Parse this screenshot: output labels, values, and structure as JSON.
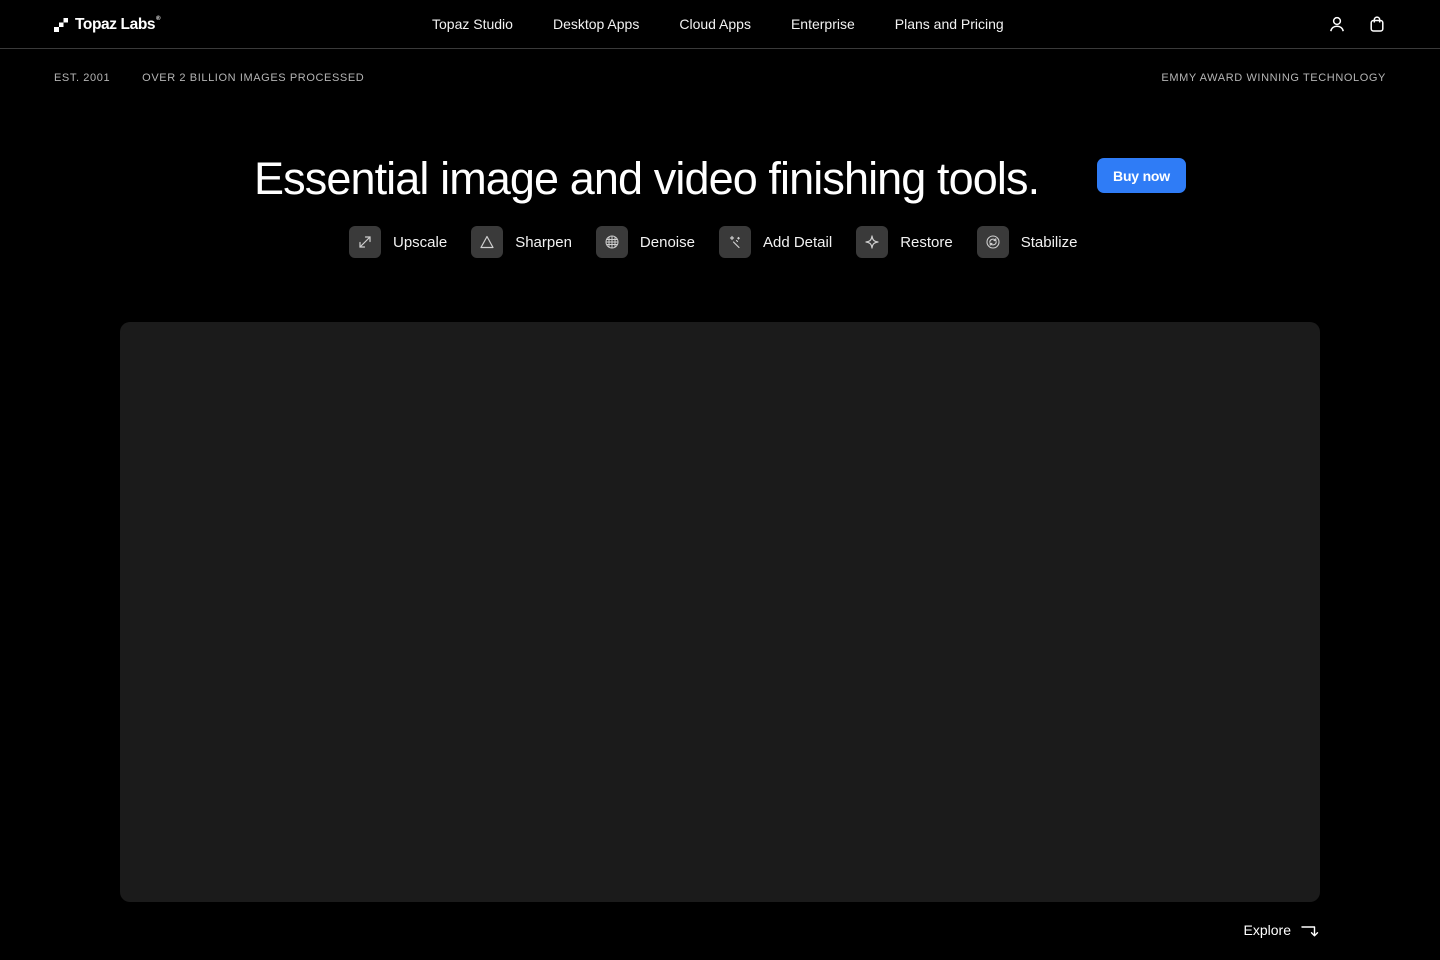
{
  "header": {
    "logo_text": "Topaz Labs",
    "logo_reg": "®",
    "nav": [
      {
        "label": "Topaz Studio"
      },
      {
        "label": "Desktop Apps"
      },
      {
        "label": "Cloud Apps"
      },
      {
        "label": "Enterprise"
      },
      {
        "label": "Plans and Pricing"
      }
    ],
    "icons": [
      "user-icon",
      "shopping-bag-icon"
    ]
  },
  "info_strip": {
    "established": "EST. 2001",
    "images_processed": "OVER 2 BILLION IMAGES PROCESSED",
    "award": "EMMY AWARD WINNING TECHNOLOGY"
  },
  "hero": {
    "headline": "Essential image and video finishing tools.",
    "cta_label": "Buy now",
    "features": [
      {
        "label": "Upscale",
        "icon": "upscale-icon"
      },
      {
        "label": "Sharpen",
        "icon": "sharpen-icon"
      },
      {
        "label": "Denoise",
        "icon": "denoise-icon"
      },
      {
        "label": "Add Detail",
        "icon": "add-detail-icon"
      },
      {
        "label": "Restore",
        "icon": "restore-icon"
      },
      {
        "label": "Stabilize",
        "icon": "stabilize-icon"
      }
    ]
  },
  "explore": {
    "label": "Explore",
    "icon": "arrow-down-right-icon"
  },
  "colors": {
    "background": "#000000",
    "accent": "#2f7cf6",
    "panel": "#1b1b1b",
    "icon_tile": "#3a3a3a",
    "muted_text": "#b5b5b5",
    "divider": "#3a3a3a"
  }
}
